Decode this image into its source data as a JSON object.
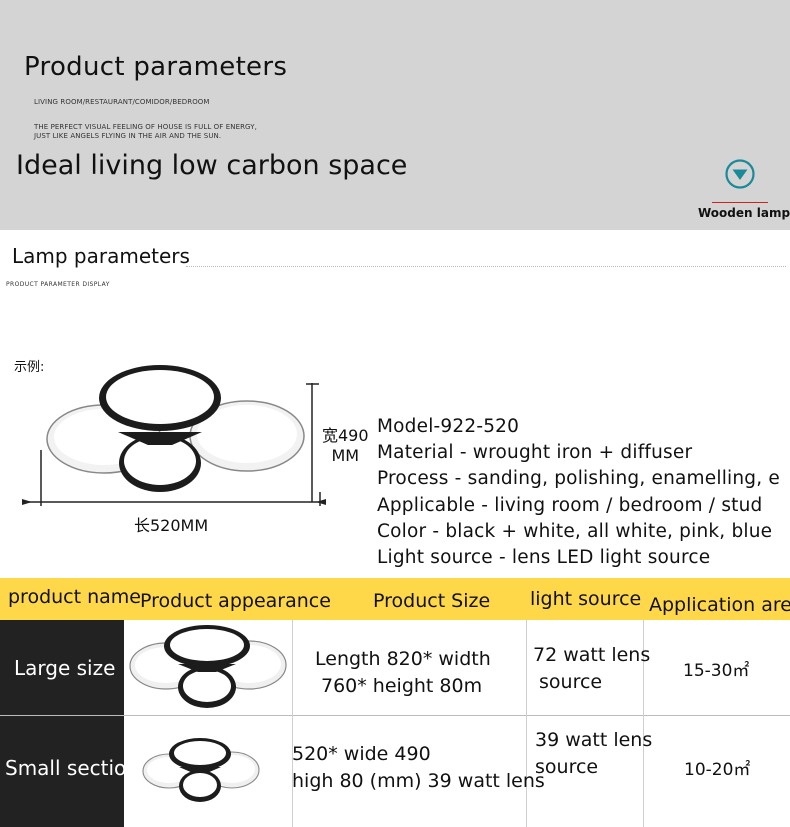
{
  "banner": {
    "title": "Product parameters",
    "subtitle": "LIVING ROOM/RESTAURANT/COMIDOR/BEDROOM",
    "tagline_line1": "THE PERFECT VISUAL FEELING OF HOUSE IS FULL OF ENERGY,",
    "tagline_line2": "JUST LIKE ANGELS FLYING IN THE AIR AND THE SUN.",
    "slogan": "Ideal living low carbon space",
    "badge_icon": "chevron-down-circle-icon",
    "badge_label": "Wooden lamp",
    "accent_color": "#1a8a9a"
  },
  "lamp_params": {
    "title": "Lamp parameters",
    "subtitle": "PRODUCT PARAMETER DISPLAY",
    "example_label": "示例:",
    "width_label_line1": "宽490",
    "width_label_line2": "MM",
    "length_label": "长520MM",
    "specs": [
      "Model-922-520",
      "Material - wrought iron + diffuser",
      "Process - sanding, polishing, enamelling, e",
      "Applicable - living room / bedroom / stud",
      "Color - black + white, all white, pink, blue",
      "Light source - lens LED light source"
    ]
  },
  "table": {
    "header_color": "#ffd84a",
    "headers": [
      "product name",
      "Product appearance",
      "Product Size",
      "light source",
      "Application are"
    ],
    "rows": [
      {
        "name": "Large size",
        "size_line1": "Length 820* width",
        "size_line2": "760* height 80m",
        "light_line1": "72 watt lens",
        "light_line2": "source",
        "area": "15-30㎡"
      },
      {
        "name": "Small sectio",
        "size_line1": "520* wide 490",
        "size_line2": "high 80 (mm) 39 watt lens",
        "light_line1": "39 watt lens",
        "light_line2": "source",
        "area": "10-20㎡"
      }
    ]
  }
}
